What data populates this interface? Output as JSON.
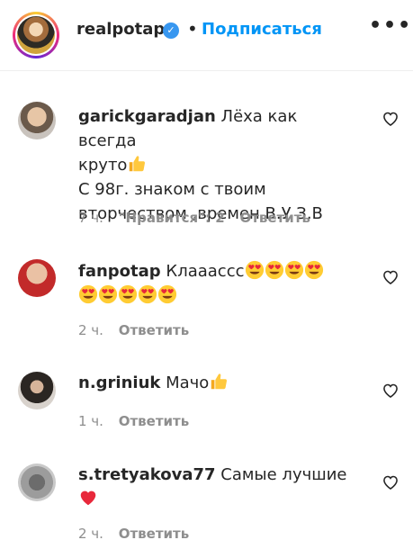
{
  "header": {
    "username": "realpotap",
    "separator": "•",
    "follow_label": "Подписаться",
    "more_label": "•••"
  },
  "comments": [
    {
      "username": "garickgaradjan",
      "lines": [
        "Лёха как всегда",
        "круто",
        "С 98г. знаком с твоим",
        "вторчеством ,времен В.У З.В"
      ],
      "time": "7 ч.",
      "likes": "\"Нравится\": 2",
      "reply_label": "Ответить"
    },
    {
      "username": "fanpotap",
      "lines": [
        "Клаааccc"
      ],
      "time": "2 ч.",
      "reply_label": "Ответить"
    },
    {
      "username": "n.griniuk",
      "lines": [
        "Мачо"
      ],
      "time": "1 ч.",
      "reply_label": "Ответить"
    },
    {
      "username": "s.tretyakova77",
      "lines": [
        "Самые лучшие"
      ],
      "time": "2 ч.",
      "reply_label": "Ответить"
    }
  ],
  "icons": {
    "verified": "verified-badge-icon",
    "like": "heart-outline-icon",
    "thumbs_up": "thumbs-up-emoji",
    "heart_eyes": "heart-eyes-emoji",
    "red_heart": "red-heart-emoji"
  },
  "colors": {
    "accent": "#0095f6",
    "verified": "#3897f0",
    "meta": "#8e8e8e",
    "text": "#262626"
  }
}
